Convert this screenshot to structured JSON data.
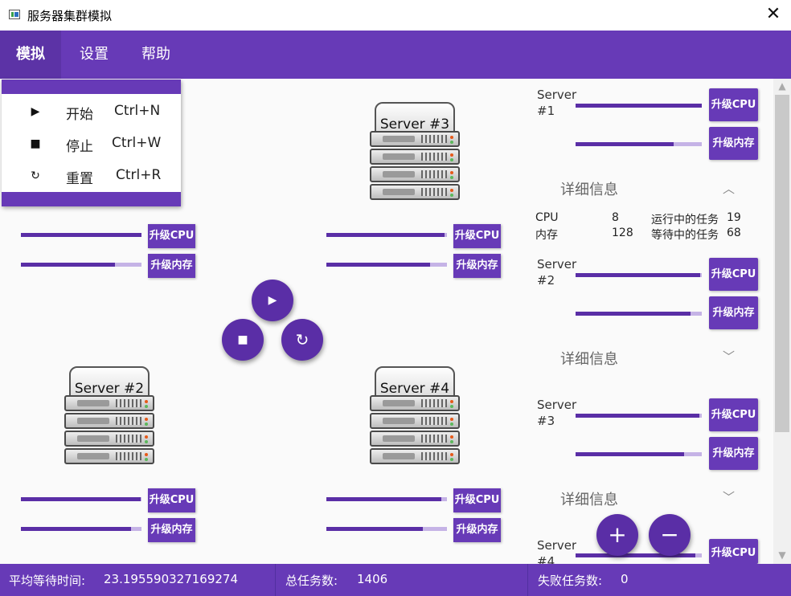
{
  "window": {
    "title": "服务器集群模拟",
    "close_glyph": "✕"
  },
  "menubar": {
    "items": [
      "模拟",
      "设置",
      "帮助"
    ],
    "active": "模拟"
  },
  "dropdown": {
    "items": [
      {
        "icon": "play-icon",
        "glyph": "▶",
        "label": "开始",
        "shortcut": "Ctrl+N"
      },
      {
        "icon": "stop-icon",
        "glyph": "■",
        "label": "停止",
        "shortcut": "Ctrl+W"
      },
      {
        "icon": "reset-icon",
        "glyph": "↻",
        "label": "重置",
        "shortcut": "Ctrl+R"
      }
    ]
  },
  "servers": [
    {
      "name": "Server #3",
      "cpu_label": "升级CPU",
      "mem_label": "升级内存",
      "cpu_level": 0.98,
      "mem_level": 0.86
    },
    {
      "name": "Server #2",
      "cpu_label": "升级CPU",
      "mem_label": "升级内存",
      "cpu_level": 0.99,
      "mem_level": 0.91
    },
    {
      "name": "Server #4",
      "cpu_label": "升级CPU",
      "mem_label": "升级内存",
      "cpu_level": 0.95,
      "mem_level": 0.8
    },
    {
      "name": "",
      "cpu_label": "升级CPU",
      "mem_label": "升级内存",
      "cpu_level": 1.0,
      "mem_level": 0.78
    }
  ],
  "controls": {
    "play_glyph": "▶",
    "stop_glyph": "■",
    "reset_glyph": "↻",
    "add_glyph": "+",
    "remove_glyph": "−"
  },
  "panel": {
    "servers": [
      {
        "line1": "Server",
        "line2": "#1",
        "cpu_label": "升级CPU",
        "mem_label": "升级内存",
        "cpu_level": 1.0,
        "mem_level": 0.78,
        "detail": "详细信息",
        "expanded": true
      },
      {
        "line1": "Server",
        "line2": "#2",
        "cpu_label": "升级CPU",
        "mem_label": "升级内存",
        "cpu_level": 0.99,
        "mem_level": 0.91,
        "detail": "详细信息",
        "expanded": false
      },
      {
        "line1": "Server",
        "line2": "#3",
        "cpu_label": "升级CPU",
        "mem_label": "升级内存",
        "cpu_level": 0.98,
        "mem_level": 0.86,
        "detail": "详细信息",
        "expanded": false
      },
      {
        "line1": "Server",
        "line2": "#4",
        "cpu_label": "升级CPU",
        "cpu_level": 0.95
      }
    ],
    "details": {
      "cpu_key": "CPU",
      "cpu_val": "8",
      "mem_key": "内存",
      "mem_val": "128",
      "running_key": "运行中的任务",
      "running_val": "19",
      "waiting_key": "等待中的任务",
      "waiting_val": "68"
    }
  },
  "status": {
    "avg_wait_label": "平均等待时间:",
    "avg_wait_value": "23.195590327169274",
    "total_label": "总任务数:",
    "total_value": "1406",
    "failed_label": "失败任务数:",
    "failed_value": "0"
  },
  "colors": {
    "primary": "#673ab7",
    "primary_dark": "#5a2ea6",
    "bar_track": "#c5b3e6"
  }
}
